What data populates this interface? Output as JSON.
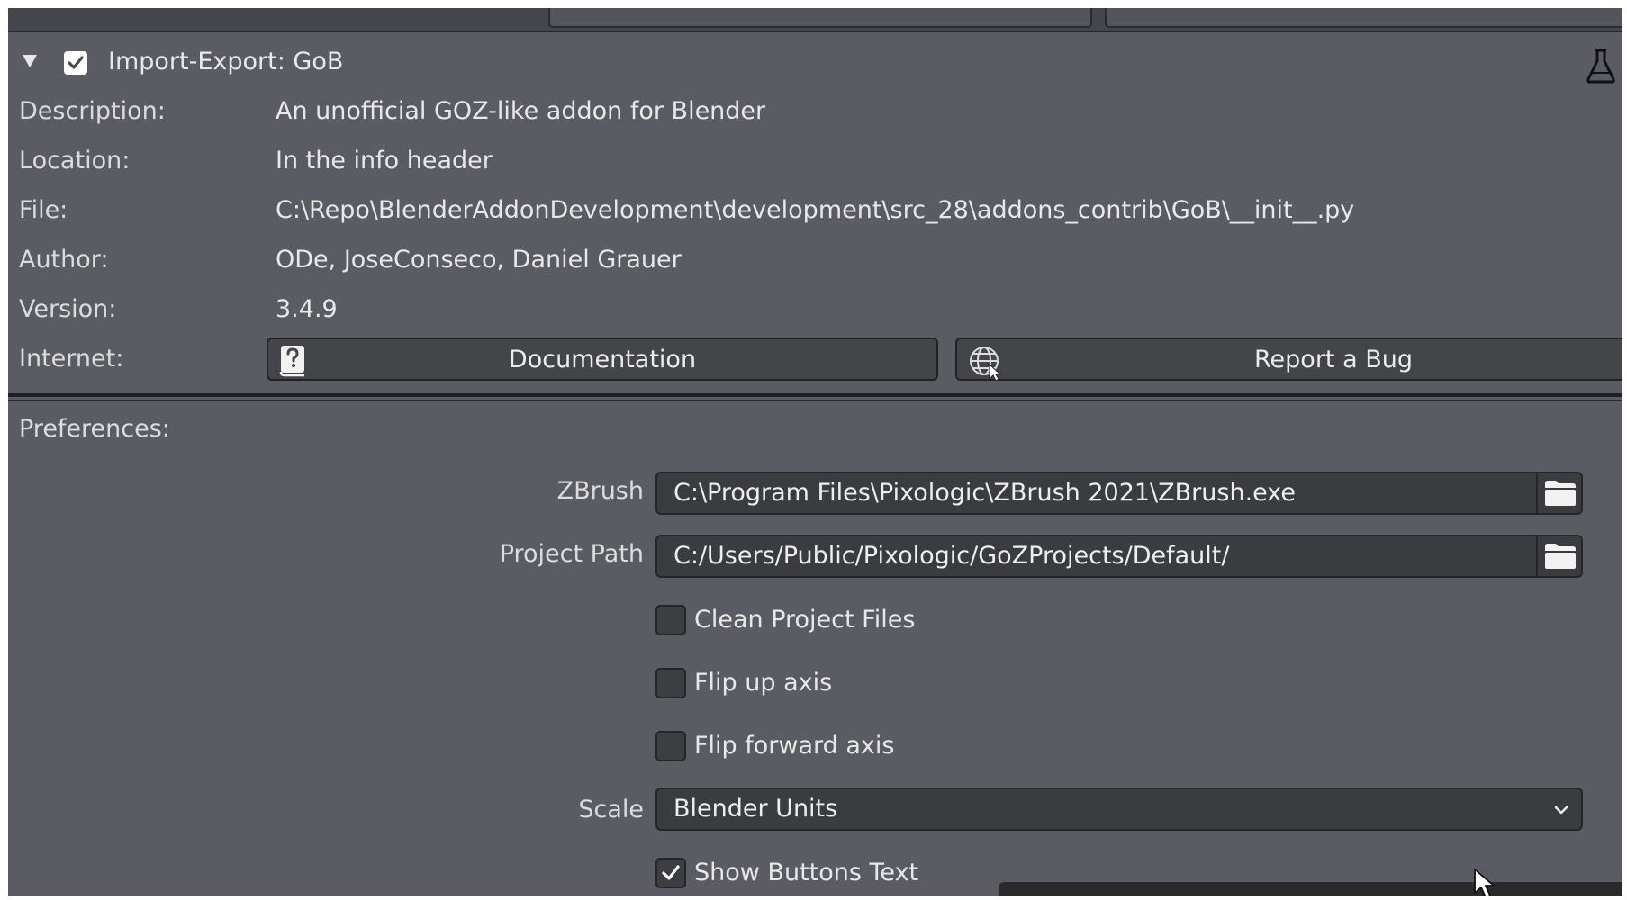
{
  "addon": {
    "name": "Import-Export: GoB",
    "enabled": true,
    "expanded": true
  },
  "info": {
    "description_label": "Description:",
    "description": "An unofficial GOZ-like addon for Blender",
    "location_label": "Location:",
    "location": "In the info header",
    "file_label": "File:",
    "file": "C:\\Repo\\BlenderAddonDevelopment\\development\\src_28\\addons_contrib\\GoB\\__init__.py",
    "author_label": "Author:",
    "author": "ODe, JoseConseco, Daniel Grauer",
    "version_label": "Version:",
    "version": "3.4.9",
    "internet_label": "Internet:",
    "documentation_button": "Documentation",
    "report_bug_button": "Report a Bug"
  },
  "preferences": {
    "header": "Preferences:",
    "zbrush_label": "ZBrush",
    "zbrush_path": "C:\\Program Files\\Pixologic\\ZBrush 2021\\ZBrush.exe",
    "project_path_label": "Project Path",
    "project_path": "C:/Users/Public/Pixologic/GoZProjects/Default/",
    "clean_project_files": "Clean Project Files",
    "flip_up_axis": "Flip up axis",
    "flip_forward_axis": "Flip forward axis",
    "scale_label": "Scale",
    "scale_value": "Blender Units",
    "show_buttons_text": "Show Buttons Text",
    "show_buttons_text_checked": true
  },
  "icons": {
    "expand": "triangle-down-icon",
    "enabled": "checkbox-checked-icon",
    "experimental": "flask-icon",
    "documentation": "help-book-icon",
    "report_bug": "globe-cursor-icon",
    "browse": "folder-icon",
    "dropdown": "chevron-down-icon"
  },
  "colors": {
    "panel_bg": "#5a5b63",
    "field_bg": "#3b3c40",
    "button_bg": "#444549",
    "text": "#e6e6e6"
  }
}
